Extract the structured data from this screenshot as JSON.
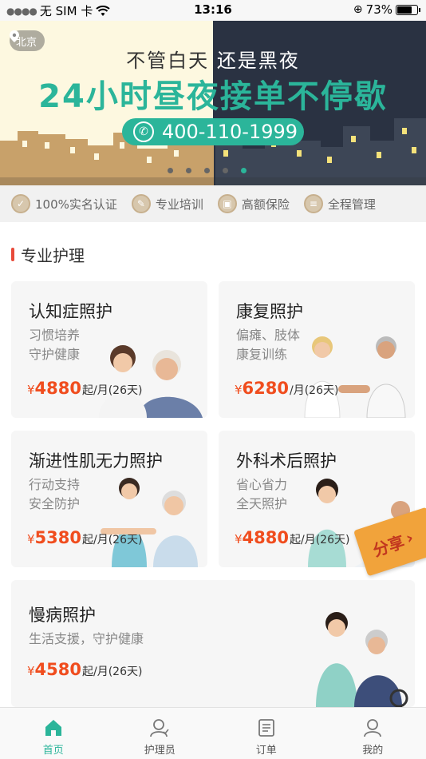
{
  "status_bar": {
    "carrier": "无 SIM 卡",
    "time": "13:16",
    "battery": "73%"
  },
  "banner": {
    "location": "北京",
    "line1_left": "不管白天",
    "line1_right": "还是黑夜",
    "headline": "24小时昼夜接单不停歇",
    "phone": "400-110-1999",
    "slide_count": 5,
    "active_slide": 4
  },
  "features": [
    {
      "label": "100%实名认证",
      "icon": "verified-icon"
    },
    {
      "label": "专业培训",
      "icon": "training-icon"
    },
    {
      "label": "高额保险",
      "icon": "insurance-icon"
    },
    {
      "label": "全程管理",
      "icon": "management-icon"
    }
  ],
  "section": {
    "title": "专业护理"
  },
  "cards": [
    {
      "title": "认知症照护",
      "desc1": "习惯培养",
      "desc2": "守护健康",
      "currency": "¥",
      "price": "4880",
      "unit": "起/月(26天)"
    },
    {
      "title": "康复照护",
      "desc1": "偏瘫、肢体",
      "desc2": "康复训练",
      "currency": "¥",
      "price": "6280",
      "unit": "/月(26天)"
    },
    {
      "title": "渐进性肌无力照护",
      "desc1": "行动支持",
      "desc2": "安全防护",
      "currency": "¥",
      "price": "5380",
      "unit": "起/月(26天)"
    },
    {
      "title": "外科术后照护",
      "desc1": "省心省力",
      "desc2": "全天照护",
      "currency": "¥",
      "price": "4880",
      "unit": "起/月(26天)"
    },
    {
      "title": "慢病照护",
      "desc1": "生活支援，守护健康",
      "desc2": "",
      "currency": "¥",
      "price": "4580",
      "unit": "起/月(26天)"
    }
  ],
  "share": {
    "label": "分享",
    "arrow": "›"
  },
  "tabbar": [
    {
      "label": "首页",
      "icon": "home-icon",
      "active": true
    },
    {
      "label": "护理员",
      "icon": "caregiver-icon",
      "active": false
    },
    {
      "label": "订单",
      "icon": "orders-icon",
      "active": false
    },
    {
      "label": "我的",
      "icon": "profile-icon",
      "active": false
    }
  ],
  "colors": {
    "accent": "#2bb59a",
    "price": "#f04d1e",
    "section_bar": "#e84a3a",
    "night": "#2a3242",
    "day": "#fdf8e0"
  }
}
